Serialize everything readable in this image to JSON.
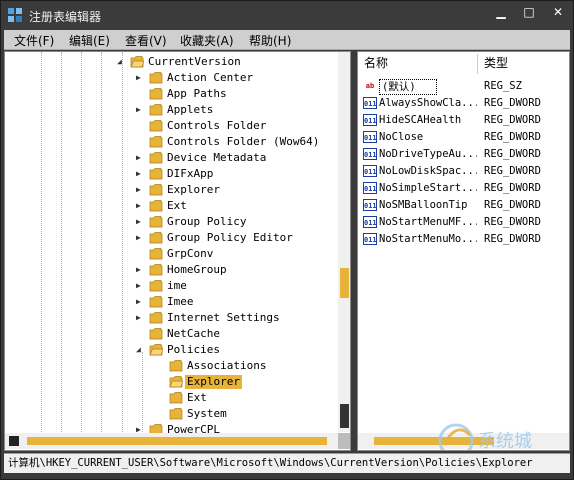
{
  "window": {
    "title": "注册表编辑器"
  },
  "menu": [
    "文件(F)",
    "编辑(E)",
    "查看(V)",
    "收藏夹(A)",
    "帮助(H)"
  ],
  "tree": {
    "parent": "CurrentVersion",
    "items": [
      {
        "label": "Action Center",
        "expandable": true
      },
      {
        "label": "App Paths",
        "expandable": false
      },
      {
        "label": "Applets",
        "expandable": true
      },
      {
        "label": "Controls Folder",
        "expandable": false
      },
      {
        "label": "Controls Folder (Wow64)",
        "expandable": false
      },
      {
        "label": "Device Metadata",
        "expandable": true
      },
      {
        "label": "DIFxApp",
        "expandable": true
      },
      {
        "label": "Explorer",
        "expandable": true
      },
      {
        "label": "Ext",
        "expandable": true
      },
      {
        "label": "Group Policy",
        "expandable": true
      },
      {
        "label": "Group Policy Editor",
        "expandable": true
      },
      {
        "label": "GrpConv",
        "expandable": false
      },
      {
        "label": "HomeGroup",
        "expandable": true
      },
      {
        "label": "ime",
        "expandable": true
      },
      {
        "label": "Imee",
        "expandable": true
      },
      {
        "label": "Internet Settings",
        "expandable": true
      },
      {
        "label": "NetCache",
        "expandable": false
      },
      {
        "label": "Policies",
        "expandable": true,
        "expanded": true
      }
    ],
    "policies_children": [
      {
        "label": "Associations",
        "selected": false
      },
      {
        "label": "Explorer",
        "selected": true
      },
      {
        "label": "Ext",
        "selected": false
      },
      {
        "label": "System",
        "selected": false
      }
    ],
    "after": "PowerCPL"
  },
  "list": {
    "columns": {
      "name": "名称",
      "type": "类型"
    },
    "rows": [
      {
        "name": "(默认)",
        "type": "REG_SZ",
        "icon": "string-value-icon"
      },
      {
        "name": "AlwaysShowCla...",
        "type": "REG_DWORD",
        "icon": "dword-value-icon"
      },
      {
        "name": "HideSCAHealth",
        "type": "REG_DWORD",
        "icon": "dword-value-icon"
      },
      {
        "name": "NoClose",
        "type": "REG_DWORD",
        "icon": "dword-value-icon"
      },
      {
        "name": "NoDriveTypeAu...",
        "type": "REG_DWORD",
        "icon": "dword-value-icon"
      },
      {
        "name": "NoLowDiskSpac...",
        "type": "REG_DWORD",
        "icon": "dword-value-icon"
      },
      {
        "name": "NoSimpleStart...",
        "type": "REG_DWORD",
        "icon": "dword-value-icon"
      },
      {
        "name": "NoSMBalloonTip",
        "type": "REG_DWORD",
        "icon": "dword-value-icon"
      },
      {
        "name": "NoStartMenuMF...",
        "type": "REG_DWORD",
        "icon": "dword-value-icon"
      },
      {
        "name": "NoStartMenuMo...",
        "type": "REG_DWORD",
        "icon": "dword-value-icon"
      }
    ]
  },
  "status": {
    "path": "计算机\\HKEY_CURRENT_USER\\Software\\Microsoft\\Windows\\CurrentVersion\\Policies\\Explorer"
  },
  "colors": {
    "selection": "#e8b33a",
    "chrome": "#3b3b3b"
  }
}
